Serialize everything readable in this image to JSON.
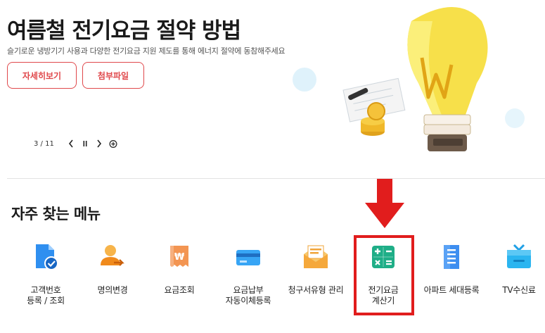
{
  "hero": {
    "title": "여름철 전기요금 절약 방법",
    "subtitle": "슬기로운 냉방기기 사용과 다양한 전기요금 지원 제도를 통해 에너지 절약에 동참해주세요",
    "detail_button": "자세히보기",
    "attach_button": "첨부파일",
    "pager": {
      "count": "3 / 11"
    }
  },
  "section": {
    "title": "자주 찾는 메뉴"
  },
  "menu": [
    {
      "label": "고객번호\n등록 / 조회",
      "icon": "document-check-icon"
    },
    {
      "label": "명의변경",
      "icon": "person-transfer-icon"
    },
    {
      "label": "요금조회",
      "icon": "bill-won-icon"
    },
    {
      "label": "요금납부\n자동이체등록",
      "icon": "credit-card-icon"
    },
    {
      "label": "청구서유형 관리",
      "icon": "envelope-icon"
    },
    {
      "label": "전기요금\n계산기",
      "icon": "calculator-icon"
    },
    {
      "label": "아파트 세대등록",
      "icon": "apartment-icon"
    },
    {
      "label": "TV수신료",
      "icon": "tv-icon"
    }
  ],
  "colors": {
    "accent": "#e0484b",
    "highlight": "#e11d1d",
    "icon_blue": "#2f8ff0",
    "icon_orange": "#f6a43a",
    "icon_green": "#1fae87"
  }
}
